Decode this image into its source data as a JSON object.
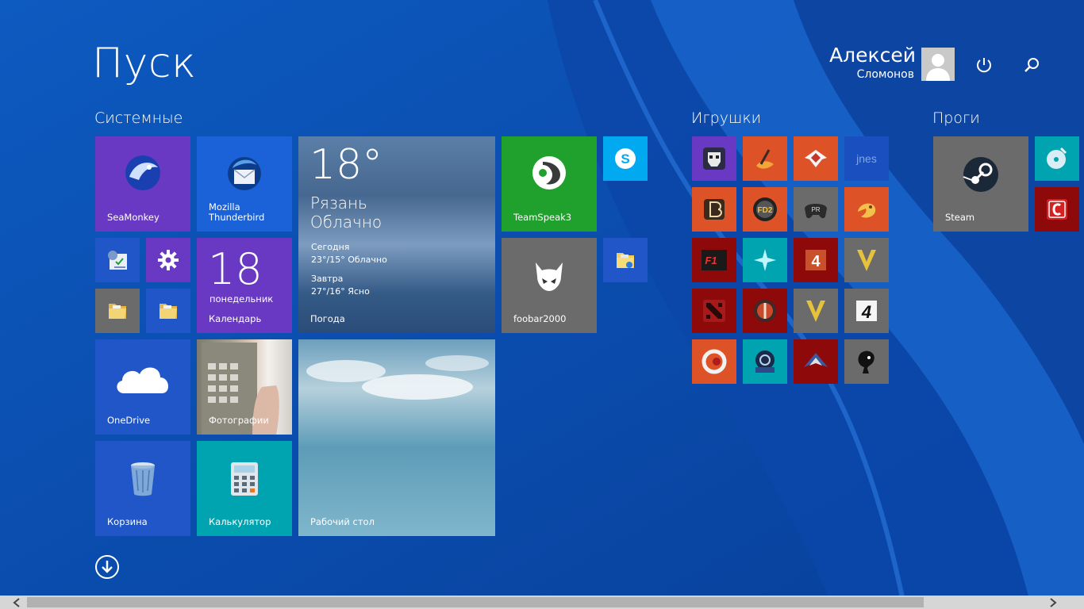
{
  "title": "Пуск",
  "user": {
    "first_name": "Алексей",
    "last_name": "Сломонов"
  },
  "groups": {
    "system": "Системные",
    "games": "Игрушки",
    "apps": "Проги"
  },
  "tiles": {
    "seamonkey": "SeaMonkey",
    "thunderbird": "Mozilla\nThunderbird",
    "weather": {
      "temp": "18°",
      "city": "Рязань",
      "condition": "Облачно",
      "today_label": "Сегодня",
      "today_value": "23°/15° Облачно",
      "tomorrow_label": "Завтра",
      "tomorrow_value": "27°/16° Ясно",
      "label": "Погода"
    },
    "teamspeak": "TeamSpeak3",
    "foobar": "foobar2000",
    "calendar": {
      "day": "18",
      "weekday": "понедельник",
      "label": "Календарь"
    },
    "onedrive": "OneDrive",
    "photos": "Фотографии",
    "recycle": "Корзина",
    "calculator": "Калькулятор",
    "desktop": "Рабочий стол",
    "steam": "Steam",
    "jnes": "jnes"
  },
  "colors": {
    "background": "#0a4fae",
    "purple": "#6a39c4",
    "blue": "#1b62d8",
    "green": "#20a02c",
    "gray": "#6b6b6b",
    "orange": "#dd5226",
    "dark_red": "#8e0a0a",
    "teal": "#00a4b0"
  },
  "icons": {
    "power": "power-icon",
    "search": "search-icon",
    "all_apps": "arrow-down-circle-icon"
  }
}
